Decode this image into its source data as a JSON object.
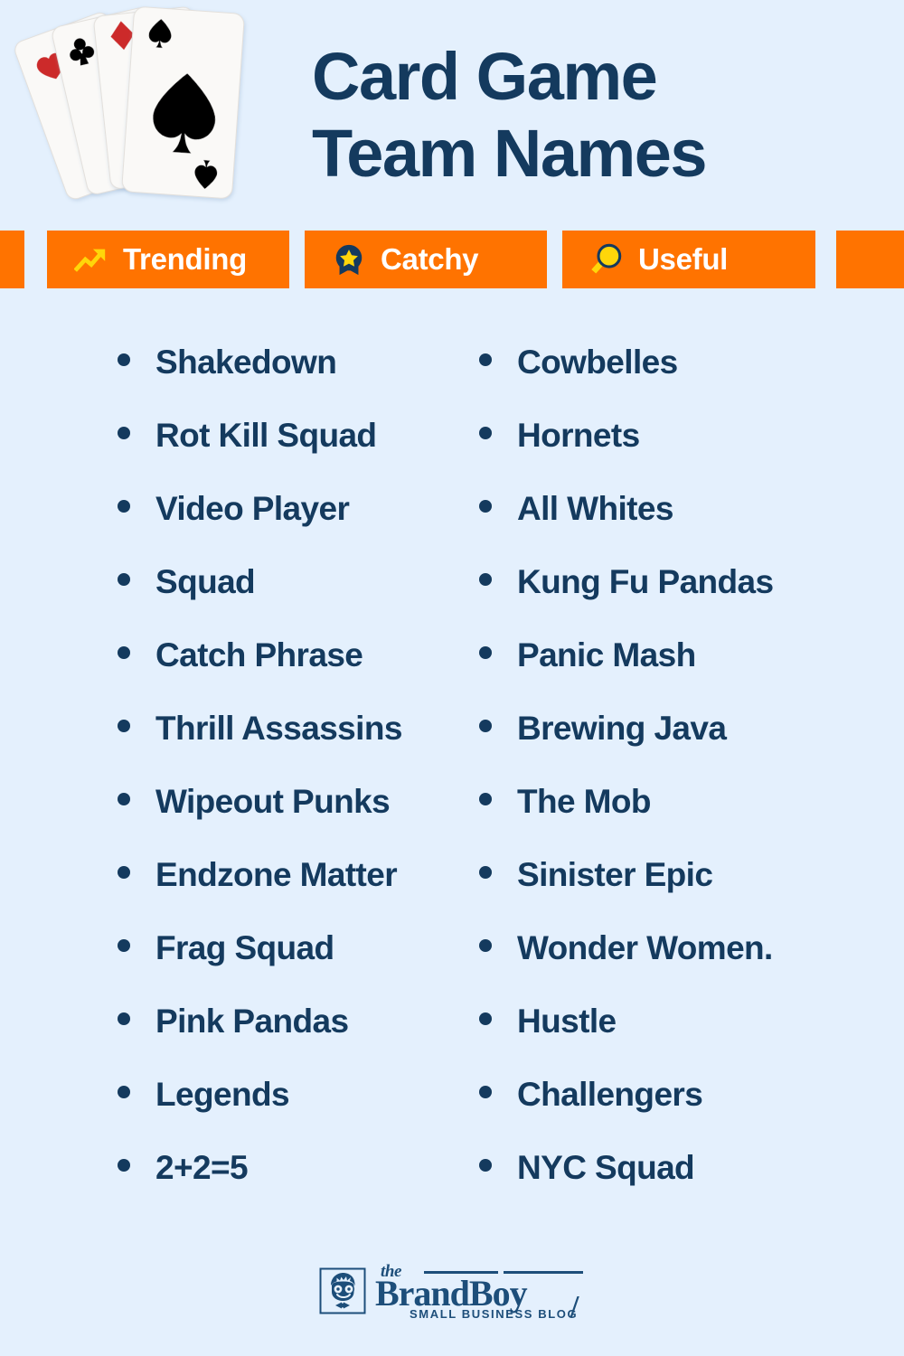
{
  "background_color": "#e4f0fd",
  "accent_color": "#ff7300",
  "navy_color": "#143a5e",
  "yellow_color": "#ffd60a",
  "header": {
    "title_line_1": "Card Game",
    "title_line_2": "Team Names",
    "artwork": {
      "name": "playing-cards-fan",
      "suits": [
        "heart",
        "club",
        "diamond",
        "spade"
      ],
      "heart_color": "#cc2b2b",
      "diamond_color": "#cc2b2b",
      "club_color": "#000000",
      "spade_color": "#000000",
      "card_face_color": "#faf9f7"
    }
  },
  "badges": [
    {
      "icon": "trending-up-icon",
      "label": "Trending"
    },
    {
      "icon": "award-star-icon",
      "label": "Catchy"
    },
    {
      "icon": "magnifier-icon",
      "label": "Useful"
    }
  ],
  "lists": {
    "left_column": [
      "Shakedown",
      "Rot Kill Squad",
      "Video Player",
      "Squad",
      "Catch Phrase",
      "Thrill Assassins",
      "Wipeout Punks",
      "Endzone Matter",
      "Frag Squad",
      "Pink Pandas",
      "Legends",
      "2+2=5"
    ],
    "right_column": [
      "Cowbelles",
      "Hornets",
      "All Whites",
      "Kung Fu Pandas",
      "Panic Mash",
      "Brewing Java",
      "The Mob",
      "Sinister Epic",
      "Wonder Women.",
      "Hustle",
      "Challengers",
      "NYC Squad"
    ]
  },
  "footer": {
    "logo_the": "the",
    "logo_name": "BrandBoy",
    "logo_tagline": "SMALL BUSINESS BLOG",
    "logo_slash": "/",
    "logo_mark": "boy-face-icon"
  }
}
